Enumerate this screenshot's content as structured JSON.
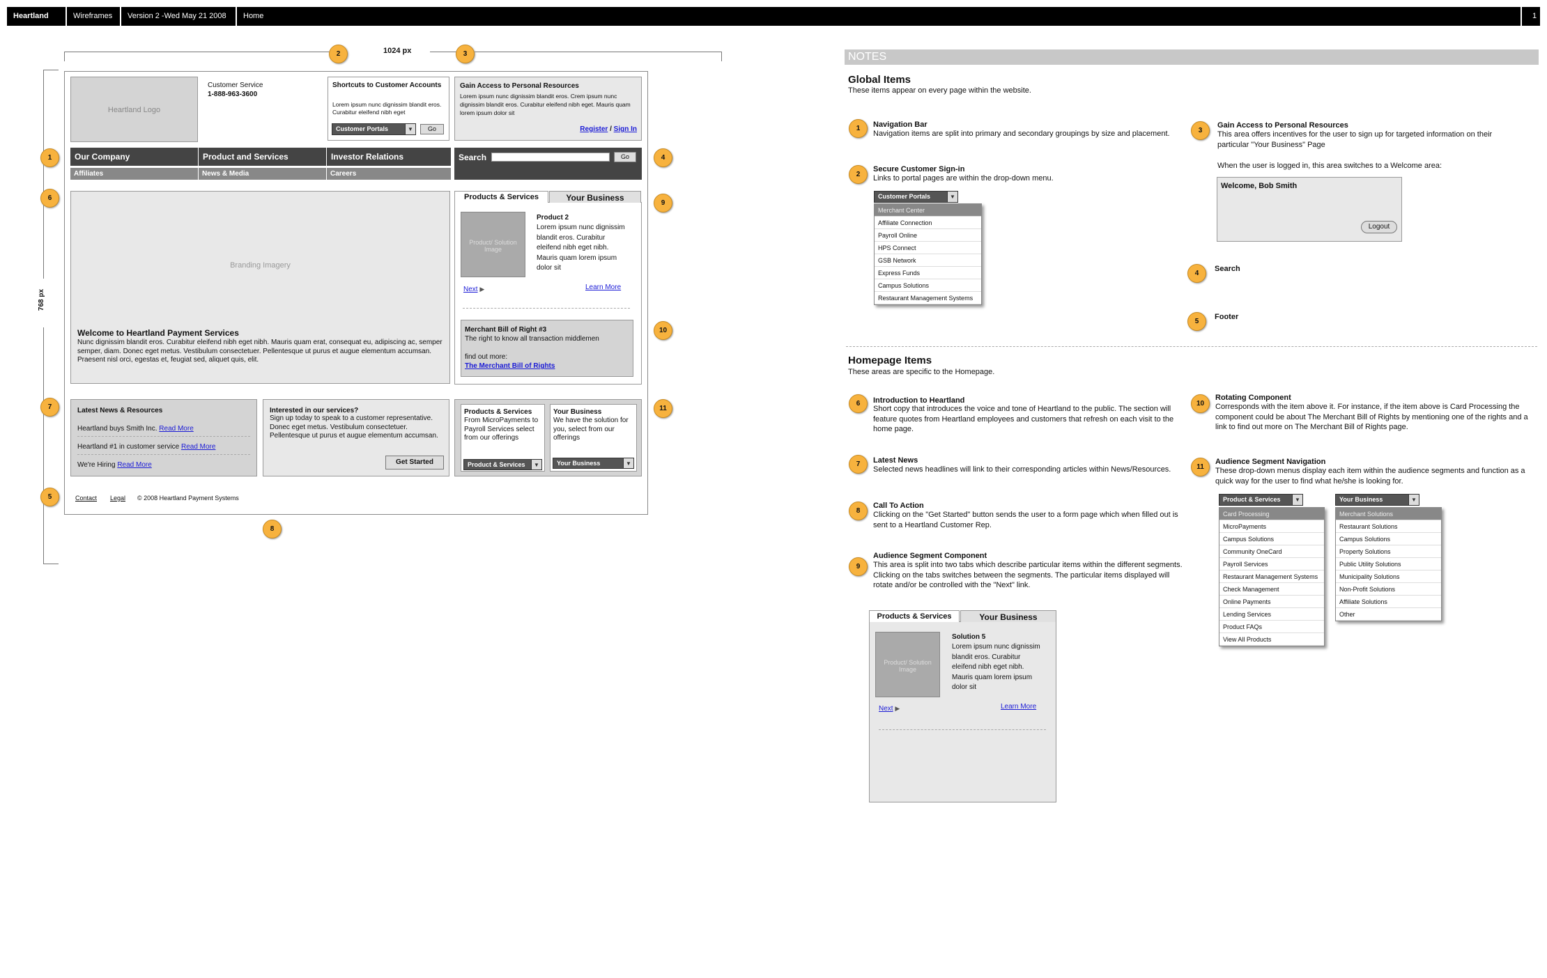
{
  "topbar": {
    "brand": "Heartland",
    "section": "Wireframes",
    "version": "Version 2 -Wed May 21 2008",
    "page": "Home",
    "page_number": "1"
  },
  "dims": {
    "width_label": "1024 px",
    "height_label": "768 px"
  },
  "markers": {
    "m1": "1",
    "m2": "2",
    "m3": "3",
    "m4": "4",
    "m5": "5",
    "m6": "6",
    "m7": "7",
    "m8": "8",
    "m9": "9",
    "m10": "10",
    "m11": "11"
  },
  "wire": {
    "logo": "Heartland Logo",
    "cs_label": "Customer Service",
    "cs_phone": "1-888-963-3600",
    "shortcuts": {
      "title": "Shortcuts to Customer Accounts",
      "text": "Lorem ipsum nunc dignissim blandit eros. Curabitur eleifend nibh eget",
      "dropdown": "Customer Portals",
      "go": "Go"
    },
    "access": {
      "title": "Gain Access to Personal Resources",
      "text": "Lorem ipsum nunc dignissim blandit eros. Crem ipsum nunc dignissim blandit eros. Curabitur eleifend nibh eget. Mauris quam lorem ipsum dolor sit",
      "register": "Register",
      "slash": " / ",
      "signin": "Sign In"
    },
    "nav": {
      "company": "Our Company",
      "products": "Product and Services",
      "investor": "Investor Relations",
      "affiliates": "Affiliates",
      "news_media": "News & Media",
      "careers": "Careers",
      "search": "Search",
      "search_go": "Go"
    },
    "branding": "Branding Imagery",
    "intro": {
      "title": "Welcome to Heartland Payment Services",
      "text": "Nunc dignissim blandit eros. Curabitur eleifend nibh eget nibh. Mauris quam erat, consequat eu, adipiscing ac, semper semper, diam. Donec eget metus. Vestibulum consectetuer. Pellentesque ut purus et augue elementum accumsan. Praesent nisl orci, egestas et, feugiat sed, aliquet quis, elit."
    },
    "seg": {
      "tab1": "Products & Services",
      "tab2": "Your Business",
      "image": "Product/ Solution Image",
      "prod_title": "Product 2",
      "prod_text": "Lorem ipsum nunc dignissim blandit eros. Curabitur eleifend nibh eget nibh. Mauris quam lorem ipsum dolor sit",
      "next": "Next",
      "learn": "Learn More"
    },
    "rotate": {
      "title": "Merchant Bill of Right #3",
      "text": "The right to know all transaction middlemen",
      "find": "find out more:",
      "link": "The Merchant Bill of Rights"
    },
    "news": {
      "title": "Latest News & Resources",
      "i1": "Heartland buys Smith Inc.",
      "i2": "Heartland #1 in customer  service",
      "i3": "We're Hiring",
      "read": "Read More"
    },
    "cta": {
      "title": "Interested in our services?",
      "text": "Sign up today to speak to a customer representative. Donec eget metus. Vestibulum consectetuer. Pellentesque ut purus et augue elementum accumsan.",
      "button": "Get Started"
    },
    "aud": {
      "p_title": "Products & Services",
      "p_text": "From MicroPayments to Payroll Services select from our offerings",
      "p_dd": "Product & Services",
      "b_title": "Your Business",
      "b_text": "We have the solution for you, select from our offerings",
      "b_dd": "Your Business"
    },
    "footer": {
      "contact": "Contact",
      "legal": "Legal",
      "copy": "© 2008 Heartland Payment Systems"
    }
  },
  "notes": {
    "header": "NOTES",
    "global_title": "Global Items",
    "global_sub": "These items appear on every page within the website.",
    "n1_title": "Navigation Bar",
    "n1_text": "Navigation items are split into primary and secondary groupings by size and placement.",
    "n2_title": "Secure Customer Sign-in",
    "n2_text": "Links to portal pages are within the drop-down menu.",
    "portal_menu": {
      "head": "Customer Portals",
      "items": [
        "Merchant Center",
        "Affiliate Connection",
        "Payroll Online",
        "HPS Connect",
        "GSB Network",
        "Express Funds",
        "Campus Solutions",
        "Restaurant Management Systems"
      ]
    },
    "n3_title": "Gain Access to Personal Resources",
    "n3_text": "This area offers incentives for the user to sign up for targeted information on their particular \"Your Business\" Page",
    "n3_text2": "When the user is logged in, this area switches to a Welcome area:",
    "welcome": "Welcome, Bob Smith",
    "logout": "Logout",
    "n4_title": "Search",
    "n5_title": "Footer",
    "home_title": "Homepage Items",
    "home_sub": "These areas are specific to the Homepage.",
    "n6_title": "Introduction to Heartland",
    "n6_text": "Short copy that introduces the voice and tone of Heartland to the public. The section will feature quotes from Heartland employees and customers that refresh on each visit to the home page.",
    "n7_title": "Latest News",
    "n7_text": "Selected news headlines will link to their corresponding articles within News/Resources.",
    "n8_title": "Call To Action",
    "n8_text": "Clicking on the \"Get Started\" button sends the user to a form page which when filled out is sent to a Heartland Customer Rep.",
    "n9_title": "Audience Segment Component",
    "n9_text": "This area is split into two tabs which describe particular items within the different segments. Clicking on the tabs switches between the segments. The particular items displayed will rotate and/or be controlled with the \"Next\" link.",
    "sample": {
      "tab1": "Products & Services",
      "tab2": "Your Business",
      "image": "Product/ Solution Image",
      "title": "Solution 5",
      "text": "Lorem ipsum nunc dignissim blandit eros. Curabitur eleifend nibh eget nibh. Mauris quam lorem ipsum dolor sit",
      "next": "Next",
      "learn": "Learn More"
    },
    "n10_title": "Rotating Component",
    "n10_text": "Corresponds with the item above it. For instance, if the item above is Card Processing the component could be about The Merchant Bill of Rights by mentioning one of the rights and a link to find out more on The Merchant Bill of Rights page.",
    "n11_title": "Audience Segment Navigation",
    "n11_text": "These drop-down menus display each item within the audience segments and function as a quick way for the user to find what he/she is looking for.",
    "prod_menu": {
      "head": "Product & Services",
      "items": [
        "Card Processing",
        "MicroPayments",
        "Campus Solutions",
        "Community OneCard",
        "Payroll Services",
        "Restaurant Management Systems",
        "Check Management",
        "Online Payments",
        "Lending Services",
        "Product FAQs",
        "View All Products"
      ]
    },
    "biz_menu": {
      "head": "Your Business",
      "items": [
        "Merchant Solutions",
        "Restaurant Solutions",
        "Campus Solutions",
        "Property Solutions",
        "Public Utility Solutions",
        "Municipality Solutions",
        "Non-Profit Solutions",
        "Affiliate Solutions",
        "Other"
      ]
    }
  }
}
